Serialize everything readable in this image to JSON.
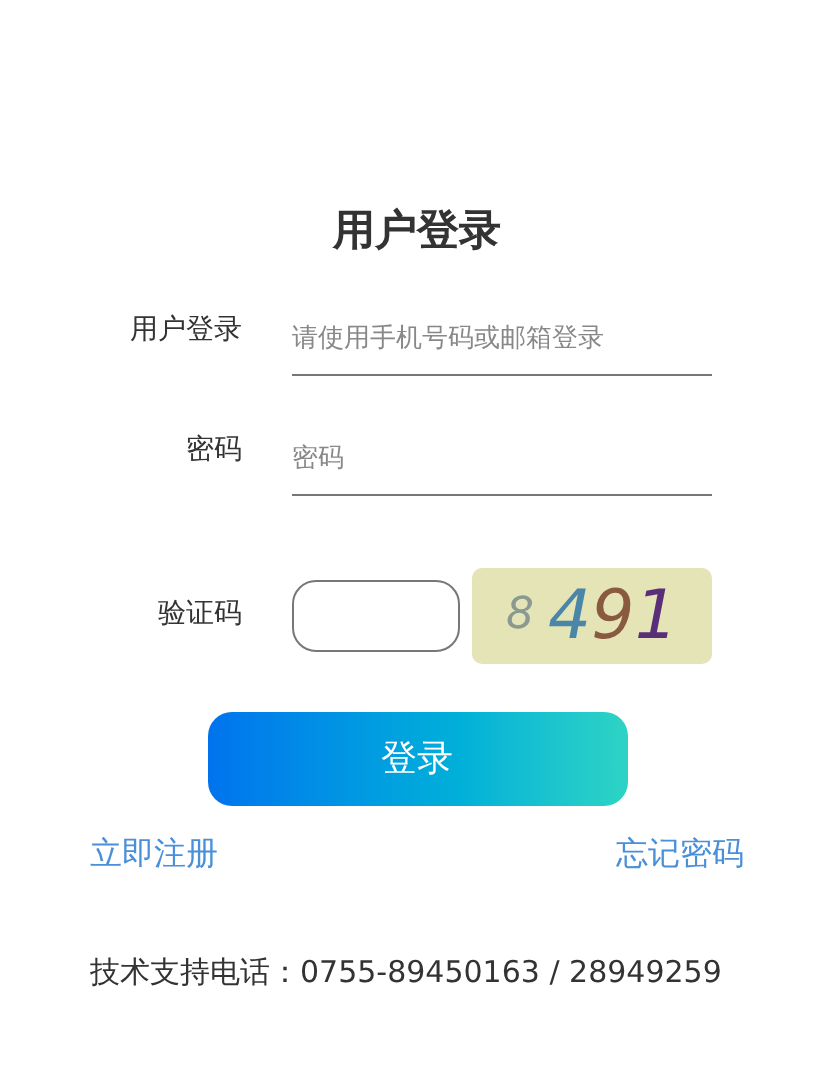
{
  "title": "用户登录",
  "fields": [
    {
      "label": "用户登录",
      "placeholder": "请使用手机号码或邮箱登录"
    },
    {
      "label": "密码",
      "placeholder": "密码"
    }
  ],
  "captcha": {
    "label": "验证码",
    "code": "8 491"
  },
  "login_button": "登录",
  "links": {
    "register": "立即注册",
    "forgot": "忘记密码"
  },
  "footer": "技术支持电话：0755-89450163 / 28949259"
}
